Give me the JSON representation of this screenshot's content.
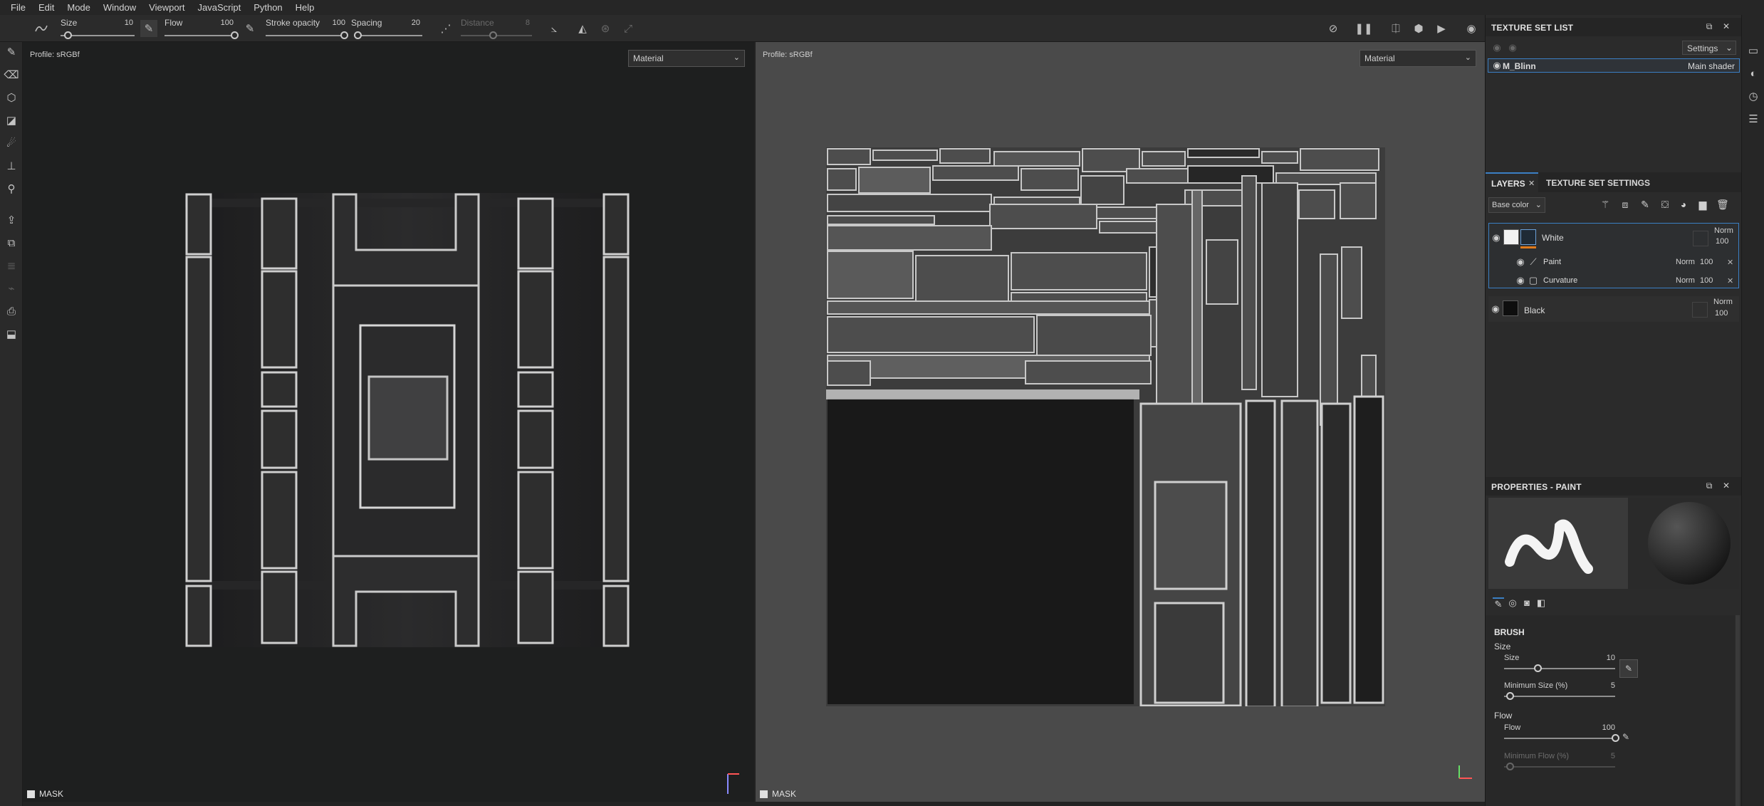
{
  "menu": [
    "File",
    "Edit",
    "Mode",
    "Window",
    "Viewport",
    "JavaScript",
    "Python",
    "Help"
  ],
  "toolbar": {
    "size_label": "Size",
    "size_value": "10",
    "size_fraction": 0.1,
    "flow_label": "Flow",
    "flow_value": "100",
    "flow_fraction": 1.0,
    "stroke_opacity_label": "Stroke opacity",
    "stroke_opacity_value": "100",
    "stroke_opacity_fraction": 1.0,
    "spacing_label": "Spacing",
    "spacing_value": "20",
    "spacing_fraction": 0.05,
    "distance_label": "Distance",
    "distance_value": "8",
    "distance_fraction": 0.45
  },
  "viewport3d": {
    "profile": "Profile: sRGBf",
    "channel": "Material",
    "mask_label": "MASK"
  },
  "viewport2d": {
    "profile": "Profile: sRGBf",
    "channel": "Material",
    "mask_label": "MASK"
  },
  "texture_set_list": {
    "title": "TEXTURE SET LIST",
    "settings_label": "Settings",
    "item_name": "M_Blinn",
    "item_shader": "Main shader"
  },
  "layers_panel": {
    "tab_layers": "LAYERS",
    "tab_texture_set_settings": "TEXTURE SET SETTINGS",
    "channel_select": "Base color",
    "layers": [
      {
        "name": "White",
        "blend": "Norm",
        "opacity": "100"
      },
      {
        "name": "Paint",
        "blend": "Norm",
        "opacity": "100"
      },
      {
        "name": "Curvature",
        "blend": "Norm",
        "opacity": "100"
      },
      {
        "name": "Black",
        "blend": "Norm",
        "opacity": "100"
      }
    ]
  },
  "properties": {
    "title": "PROPERTIES - PAINT",
    "section_brush": "BRUSH",
    "group_size": "Size",
    "size_label": "Size",
    "size_value": "10",
    "size_fraction": 0.3,
    "min_size_label": "Minimum Size (%)",
    "min_size_value": "5",
    "min_size_fraction": 0.05,
    "group_flow": "Flow",
    "flow_label": "Flow",
    "flow_value": "100",
    "flow_fraction": 1.0,
    "min_flow_label": "Minimum Flow (%)",
    "min_flow_value": "5",
    "min_flow_fraction": 0.05
  },
  "colors": {
    "accent": "#3b7fc4",
    "mask_orange": "#e07a1a",
    "viewport3d_bg": "#1e1f1f",
    "viewport2d_bg": "#4a4a4a"
  }
}
